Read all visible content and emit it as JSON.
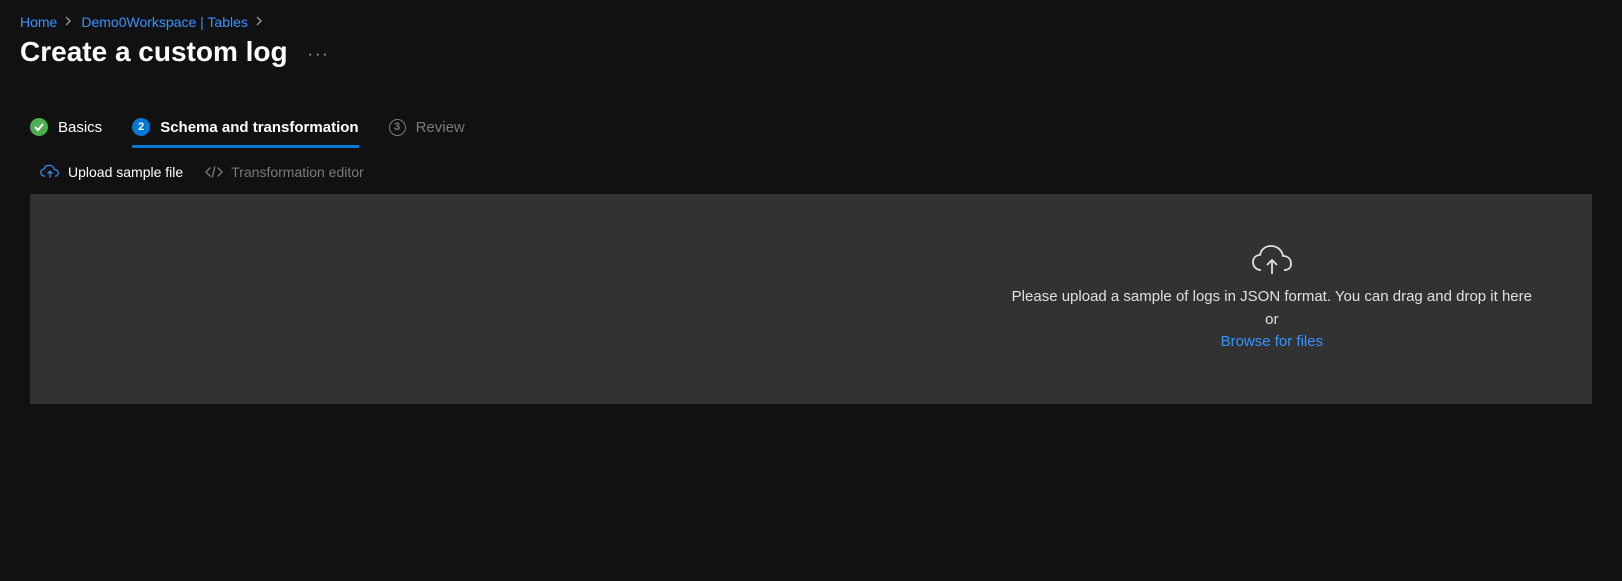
{
  "breadcrumb": {
    "items": [
      {
        "label": "Home"
      },
      {
        "label": "Demo0Workspace | Tables"
      }
    ]
  },
  "header": {
    "title": "Create a custom log"
  },
  "tabs": {
    "items": [
      {
        "label": "Basics",
        "state": "completed"
      },
      {
        "label": "Schema and transformation",
        "number": "2",
        "state": "active"
      },
      {
        "label": "Review",
        "number": "3",
        "state": "disabled"
      }
    ]
  },
  "subtabs": {
    "upload_label": "Upload sample file",
    "editor_label": "Transformation editor"
  },
  "upload": {
    "instruction_line1": "Please upload a sample of logs in JSON format. You can drag and drop it here",
    "instruction_line2": "or",
    "browse_label": "Browse for files"
  }
}
